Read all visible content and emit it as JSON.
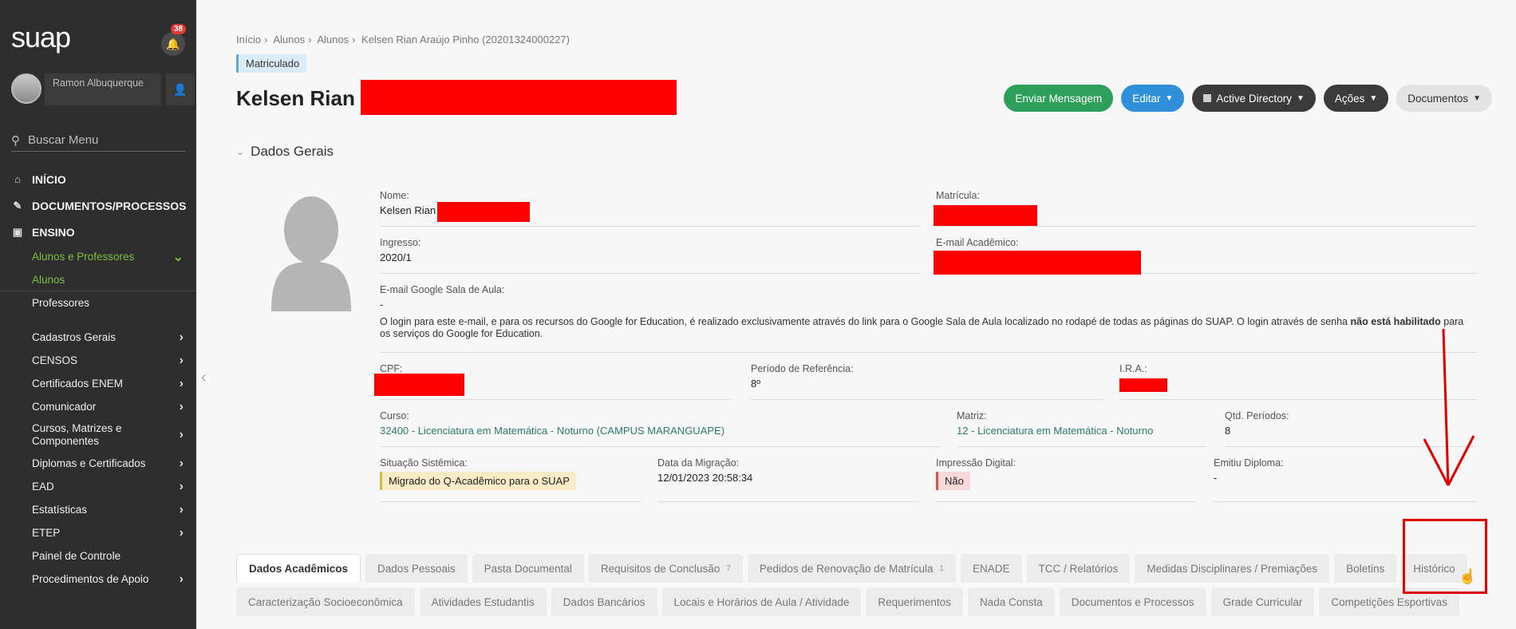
{
  "sidebar": {
    "logo": "suap",
    "notification_count": "38",
    "user_name": "Ramon Albuquerque",
    "search_placeholder": "Buscar Menu",
    "main_items": [
      {
        "label": "INÍCIO"
      },
      {
        "label": "DOCUMENTOS/PROCESSOS"
      },
      {
        "label": "ENSINO"
      }
    ],
    "ensino_sub": {
      "group": "Alunos e Professores",
      "current": "Alunos",
      "professores": "Professores"
    },
    "menu_items": [
      "Cadastros Gerais",
      "CENSOS",
      "Certificados ENEM",
      "Comunicador",
      "Cursos, Matrizes e Componentes",
      "Diplomas e Certificados",
      "EAD",
      "Estatísticas",
      "ETEP",
      "Painel de Controle",
      "Procedimentos de Apoio"
    ]
  },
  "breadcrumb": [
    "Início",
    "Alunos",
    "Alunos",
    "Kelsen Rian Araújo Pinho (20201324000227)"
  ],
  "status": "Matriculado",
  "page_title": "Kelsen Rian A",
  "actions": {
    "message": "Enviar Mensagem",
    "edit": "Editar",
    "ad": "Active Directory",
    "acoes": "Ações",
    "documentos": "Documentos"
  },
  "section_title": "Dados Gerais",
  "fields": {
    "nome_label": "Nome:",
    "nome_value": "Kelsen Rian",
    "matricula_label": "Matrícula:",
    "ingresso_label": "Ingresso:",
    "ingresso_value": "2020/1",
    "email_academico_label": "E-mail Acadêmico:",
    "email_google_label": "E-mail Google Sala de Aula:",
    "email_google_value": "-",
    "note_part1": "O login para este e-mail, e para os recursos do Google for Education, é realizado exclusivamente através do link para o Google Sala de Aula localizado no rodapé de todas as páginas do SUAP. O login através de senha ",
    "note_bold": "não está habilitado",
    "note_part2": " para os serviços do Google for Education.",
    "cpf_label": "CPF:",
    "periodo_label": "Período de Referência:",
    "periodo_value": "8º",
    "ira_label": "I.R.A.:",
    "curso_label": "Curso:",
    "curso_value": "32400 - Licenciatura em Matemática - Noturno (CAMPUS MARANGUAPE)",
    "matriz_label": "Matriz:",
    "matriz_value": "12 - Licenciatura em Matemática - Noturno",
    "qtd_label": "Qtd. Períodos:",
    "qtd_value": "8",
    "situacao_label": "Situação Sistêmica:",
    "situacao_value": "Migrado do Q-Acadêmico para o SUAP",
    "migracao_label": "Data da Migração:",
    "migracao_value": "12/01/2023 20:58:34",
    "digital_label": "Impressão Digital:",
    "digital_value": "Não",
    "diploma_label": "Emitiu Diploma:",
    "diploma_value": "-"
  },
  "tabs_row1": [
    {
      "label": "Dados Acadêmicos",
      "count": ""
    },
    {
      "label": "Dados Pessoais",
      "count": ""
    },
    {
      "label": "Pasta Documental",
      "count": ""
    },
    {
      "label": "Requisitos de Conclusão",
      "count": "7"
    },
    {
      "label": "Pedidos de Renovação de Matrícula",
      "count": "1"
    },
    {
      "label": "ENADE",
      "count": ""
    },
    {
      "label": "TCC / Relatórios",
      "count": ""
    },
    {
      "label": "Medidas Disciplinares / Premiações",
      "count": ""
    },
    {
      "label": "Boletins",
      "count": ""
    },
    {
      "label": "Histórico",
      "count": ""
    }
  ],
  "tabs_row2": [
    "Caracterização Socioeconômica",
    "Atividades Estudantis",
    "Dados Bancários",
    "Locais e Horários de Aula / Atividade",
    "Requerimentos",
    "Nada Consta",
    "Documentos e Processos",
    "Grade Curricular",
    "Competições Esportivas"
  ],
  "colors": {
    "sidebar_bg": "#2e2e2e",
    "accent_green": "#7fbf3f",
    "annotation_red": "#e00000"
  }
}
